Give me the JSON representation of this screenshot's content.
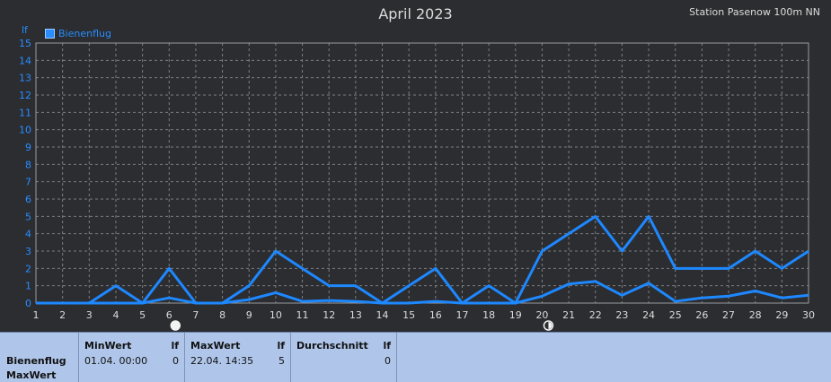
{
  "header": {
    "title": "April 2023",
    "station": "Station Pasenow 100m NN"
  },
  "legend": {
    "label": "Bienenflug"
  },
  "chart_data": {
    "type": "line",
    "title": "April 2023",
    "ylabel": "lf",
    "xlim": [
      1,
      30
    ],
    "ylim": [
      0,
      15
    ],
    "x_ticks": [
      1,
      2,
      3,
      4,
      5,
      6,
      7,
      8,
      9,
      10,
      11,
      12,
      13,
      14,
      15,
      16,
      17,
      18,
      19,
      20,
      21,
      22,
      23,
      24,
      25,
      26,
      27,
      28,
      29,
      30
    ],
    "y_ticks": [
      0,
      1,
      2,
      3,
      4,
      5,
      6,
      7,
      8,
      9,
      10,
      11,
      12,
      13,
      14,
      15
    ],
    "grid": true,
    "legend_position": "top-left",
    "series": [
      {
        "name": "Bienenflug",
        "color": "#1e88ff",
        "x": [
          1,
          2,
          3,
          4,
          5,
          6,
          7,
          8,
          9,
          10,
          11,
          12,
          13,
          14,
          15,
          16,
          17,
          18,
          19,
          20,
          21,
          22,
          23,
          24,
          25,
          26,
          27,
          28,
          29,
          30
        ],
        "values": [
          0,
          0,
          0,
          1,
          0,
          2,
          0,
          0,
          1,
          3,
          2,
          1,
          1,
          0,
          1,
          2,
          0,
          1,
          0,
          3,
          4,
          5,
          3,
          5,
          2,
          2,
          2,
          3,
          2,
          3
        ]
      },
      {
        "color": "#1e88ff",
        "x": [
          1,
          2,
          3,
          4,
          5,
          6,
          7,
          8,
          9,
          10,
          11,
          12,
          13,
          14,
          15,
          16,
          17,
          18,
          19,
          20,
          21,
          22,
          23,
          24,
          25,
          26,
          27,
          28,
          29,
          30
        ],
        "values": [
          0,
          0,
          0,
          0,
          0,
          0.3,
          0,
          0,
          0.2,
          0.6,
          0.1,
          0.15,
          0.1,
          0,
          0,
          0.1,
          0,
          0,
          0,
          0.4,
          1.1,
          1.25,
          0.45,
          1.15,
          0.1,
          0.3,
          0.4,
          0.7,
          0.3,
          0.45
        ]
      }
    ],
    "moon_markers": [
      {
        "day": 6,
        "phase": "full-moon"
      },
      {
        "day": 20,
        "phase": "new-moon"
      }
    ]
  },
  "footer": {
    "row_label_1": "Bienenflug",
    "row_label_2": "MaxWert",
    "min": {
      "header": "MinWert",
      "unit": "lf",
      "date": "01.04.  00:00",
      "value": "0"
    },
    "max": {
      "header": "MaxWert",
      "unit": "lf",
      "date": "22.04.  14:35",
      "value": "5"
    },
    "avg": {
      "header": "Durchschnitt",
      "unit": "lf",
      "value": "0"
    }
  }
}
